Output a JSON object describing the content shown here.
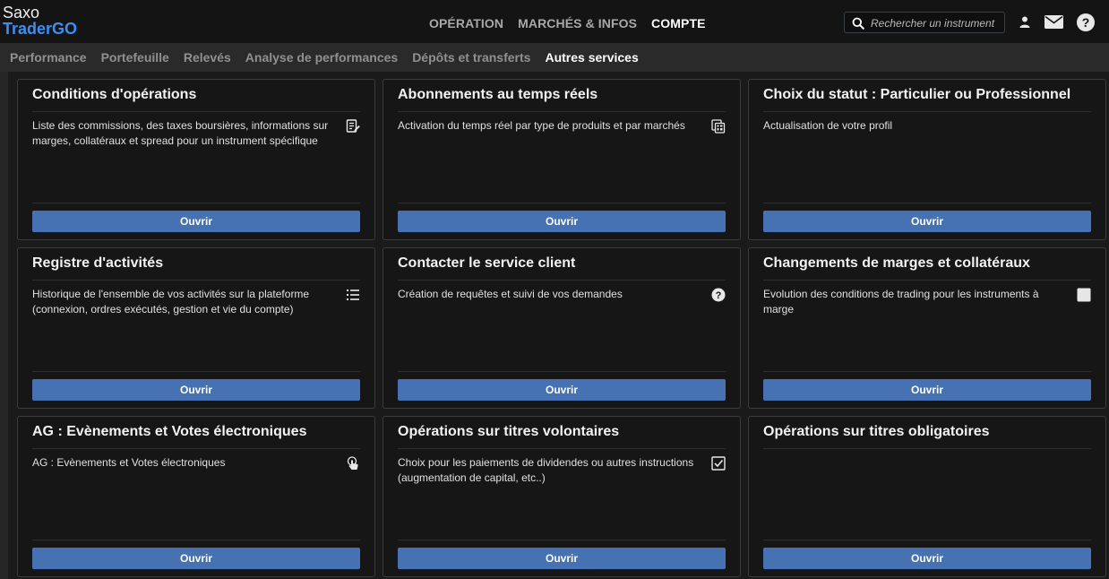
{
  "logo": {
    "line1": "Saxo",
    "line2": "TraderGO"
  },
  "main_nav": [
    {
      "label": "OPÉRATION",
      "active": false
    },
    {
      "label": "MARCHÉS & INFOS",
      "active": false
    },
    {
      "label": "COMPTE",
      "active": true
    }
  ],
  "search": {
    "placeholder": "Rechercher un instrument",
    "value": ""
  },
  "sub_nav": [
    {
      "label": "Performance",
      "active": false
    },
    {
      "label": "Portefeuille",
      "active": false
    },
    {
      "label": "Relevés",
      "active": false
    },
    {
      "label": "Analyse de performances",
      "active": false
    },
    {
      "label": "Dépôts et transferts",
      "active": false
    },
    {
      "label": "Autres services",
      "active": true
    }
  ],
  "colors": {
    "accent_button": "#4672b4",
    "logo_blue": "#3b8ef3",
    "background": "#1a1a1a",
    "card": "#161616"
  },
  "cards": [
    {
      "title": "Conditions d'opérations",
      "description": "Liste des commissions, des taxes boursières, informations sur marges, collatéraux et spread pour un instrument spécifique",
      "icon": "edit-list-icon",
      "button": "Ouvrir"
    },
    {
      "title": "Abonnements au temps réels",
      "description": "Activation du temps réel par type de produits et par marchés",
      "icon": "subscription-icon",
      "button": "Ouvrir"
    },
    {
      "title": "Choix du statut : Particulier ou Professionnel",
      "description": "Actualisation de votre profil",
      "icon": "",
      "button": "Ouvrir"
    },
    {
      "title": "Registre d'activités",
      "description": "Historique de l'ensemble de vos activités sur la plateforme (connexion, ordres exécutés, gestion et vie du compte)",
      "icon": "list-icon",
      "button": "Ouvrir"
    },
    {
      "title": "Contacter le service client",
      "description": "Création de requêtes et suivi de vos demandes",
      "icon": "help-circle-icon",
      "button": "Ouvrir"
    },
    {
      "title": "Changements de marges et collatéraux",
      "description": "Evolution des conditions de trading pour les instruments à marge",
      "icon": "blank-square-icon",
      "button": "Ouvrir"
    },
    {
      "title": "AG : Evènements et Votes électroniques",
      "description": "AG : Evènements et Votes électroniques",
      "icon": "touch-vote-icon",
      "button": "Ouvrir"
    },
    {
      "title": "Opérations sur titres volontaires",
      "description": "Choix pour les paiements de dividendes ou autres instructions (augmentation de capital, etc..)",
      "icon": "checkbox-checked-icon",
      "button": "Ouvrir"
    },
    {
      "title": "Opérations sur titres obligatoires",
      "description": "",
      "icon": "",
      "button": "Ouvrir"
    }
  ]
}
